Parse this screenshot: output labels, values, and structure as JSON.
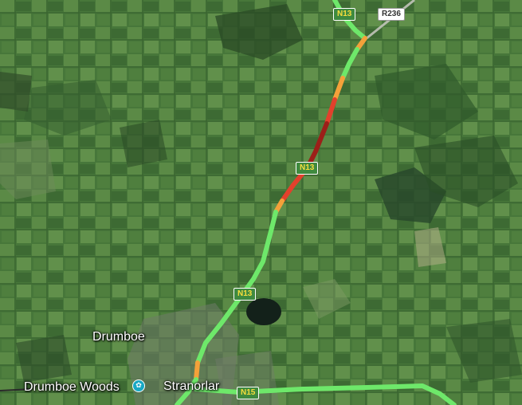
{
  "map": {
    "view": "satellite",
    "colors": {
      "traffic_free": "#6ee86a",
      "traffic_moderate": "#f4a13a",
      "traffic_slow": "#e2402c",
      "traffic_heavy": "#9c1f19",
      "poi": "#17a8c4"
    }
  },
  "roads": {
    "n13_a": "N13",
    "n13_b": "N13",
    "n13_c": "N13",
    "n15": "N15",
    "r236": "R236"
  },
  "places": {
    "drumboe": "Drumboe",
    "drumboe_woods": "Drumboe Woods",
    "stranorlar": "Stranorlar"
  },
  "poi_icon": "park-icon"
}
